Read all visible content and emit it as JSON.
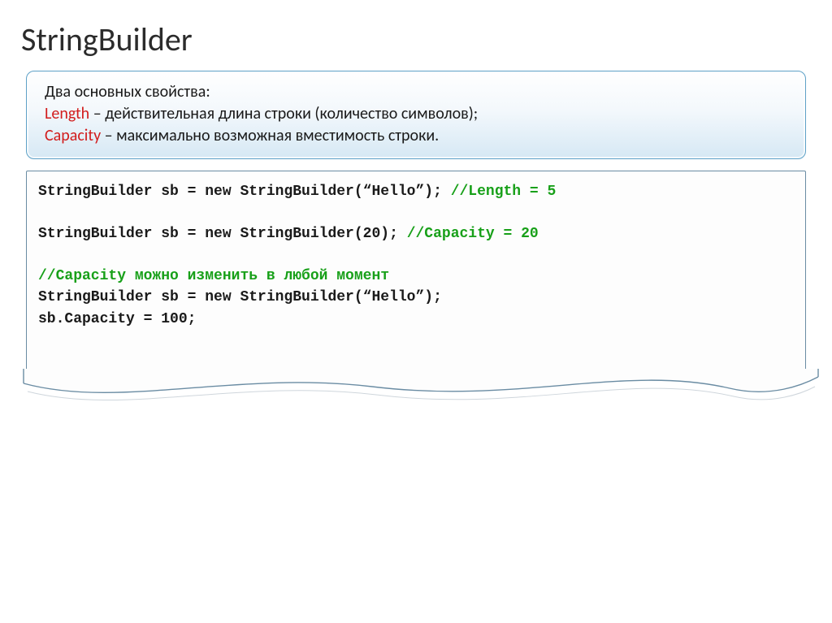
{
  "title": "StringBuilder",
  "info": {
    "intro": "Два основных свойства:",
    "line1_prop": "Length",
    "line1_rest": " – действительная длина строки (количество символов);",
    "line2_prop": "Capacity",
    "line2_rest": " – максимально возможная вместимость строки."
  },
  "code": {
    "l1_code": "StringBuilder sb = new StringBuilder(“Hello”); ",
    "l1_comment": "//Length = 5",
    "blank1": "",
    "l2_code": "StringBuilder sb = new StringBuilder(20); ",
    "l2_comment": "//Capacity = 20",
    "blank2": "",
    "l3_comment": "//Capacity можно изменить в любой момент",
    "l4_code": "StringBuilder sb = new StringBuilder(“Hello”);",
    "l5_code": "sb.Capacity = 100;"
  }
}
